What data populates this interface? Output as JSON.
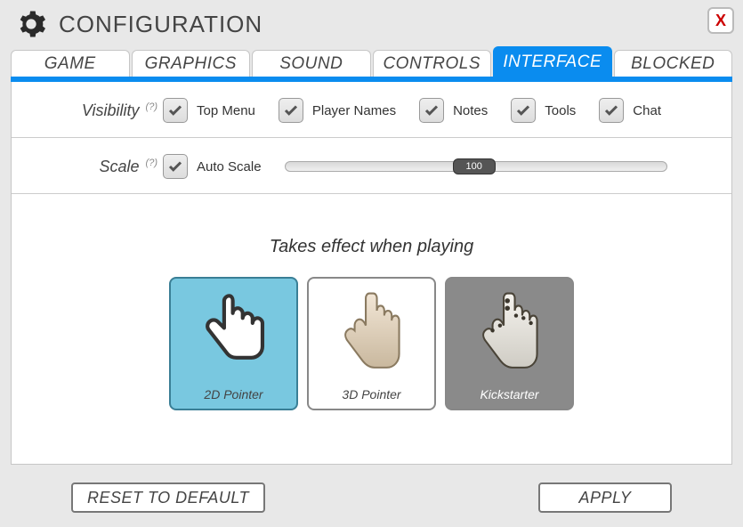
{
  "header": {
    "title": "CONFIGURATION",
    "close_label": "X"
  },
  "tabs": [
    {
      "label": "GAME",
      "active": false
    },
    {
      "label": "GRAPHICS",
      "active": false
    },
    {
      "label": "SOUND",
      "active": false
    },
    {
      "label": "CONTROLS",
      "active": false
    },
    {
      "label": "INTERFACE",
      "active": true
    },
    {
      "label": "BLOCKED",
      "active": false
    }
  ],
  "visibility": {
    "label": "Visibility",
    "help": "(?)",
    "options": [
      {
        "label": "Top Menu",
        "checked": true
      },
      {
        "label": "Player Names",
        "checked": true
      },
      {
        "label": "Notes",
        "checked": true
      },
      {
        "label": "Tools",
        "checked": true
      },
      {
        "label": "Chat",
        "checked": true
      }
    ]
  },
  "scale": {
    "label": "Scale",
    "help": "(?)",
    "auto_label": "Auto Scale",
    "auto_checked": true,
    "value": "100"
  },
  "pointer": {
    "heading": "Takes effect when playing",
    "options": [
      {
        "label": "2D Pointer",
        "selected": true,
        "style": "selected"
      },
      {
        "label": "3D Pointer",
        "selected": false,
        "style": "alt"
      },
      {
        "label": "Kickstarter",
        "selected": false,
        "style": "locked"
      }
    ]
  },
  "footer": {
    "reset": "RESET TO DEFAULT",
    "apply": "APPLY"
  }
}
